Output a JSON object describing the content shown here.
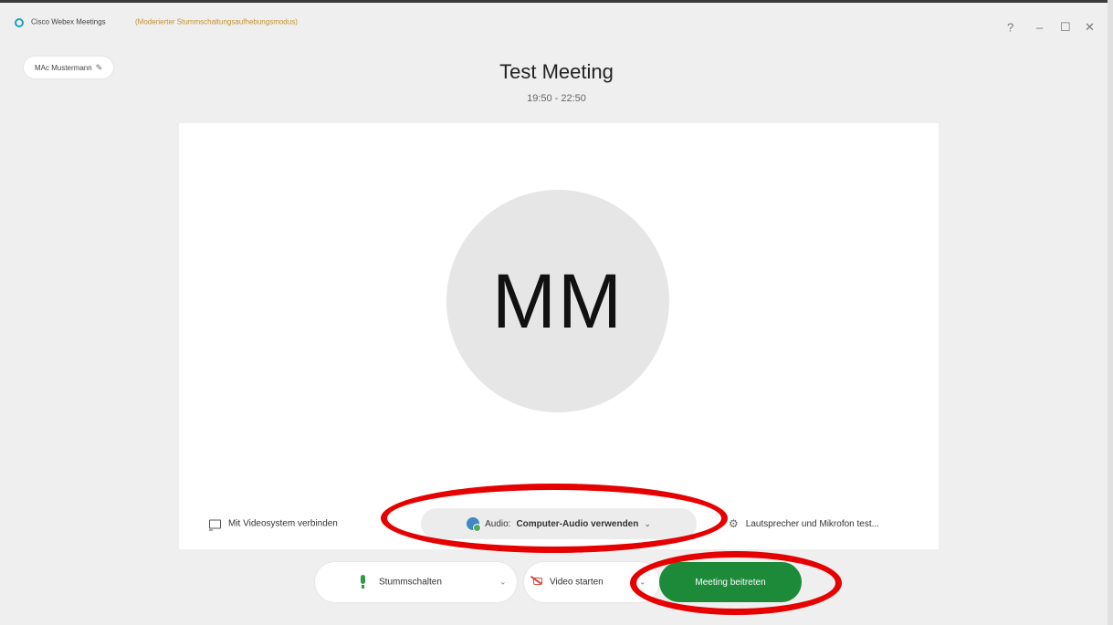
{
  "window": {
    "title": "Cisco Webex Meetings",
    "mode": "(Moderierter Stummschaltungsaufhebungsmodus)",
    "controls": {
      "help": "?",
      "minimize": "–",
      "maximize": "☐",
      "close": "✕"
    }
  },
  "user": {
    "name": "MAc Mustermann"
  },
  "meeting": {
    "title": "Test Meeting",
    "time": "19:50 - 22:50"
  },
  "avatar": {
    "initials": "MM"
  },
  "options": {
    "video_system": "Mit Videosystem verbinden",
    "audio_prefix": "Audio:",
    "audio_value": "Computer-Audio verwenden",
    "speaker_test": "Lautsprecher und Mikrofon test..."
  },
  "bottom_bar": {
    "mute": "Stummschalten",
    "video": "Video starten",
    "join": "Meeting beitreten"
  },
  "icons": {
    "chevron_down": "⌄",
    "pencil": "✎",
    "gear": "⚙"
  },
  "colors": {
    "join_green": "#1d8a3a",
    "annotation_red": "#e60000",
    "mode_text": "#c09030",
    "mic_green": "#2e9b4a",
    "cam_red": "#d9463c"
  }
}
